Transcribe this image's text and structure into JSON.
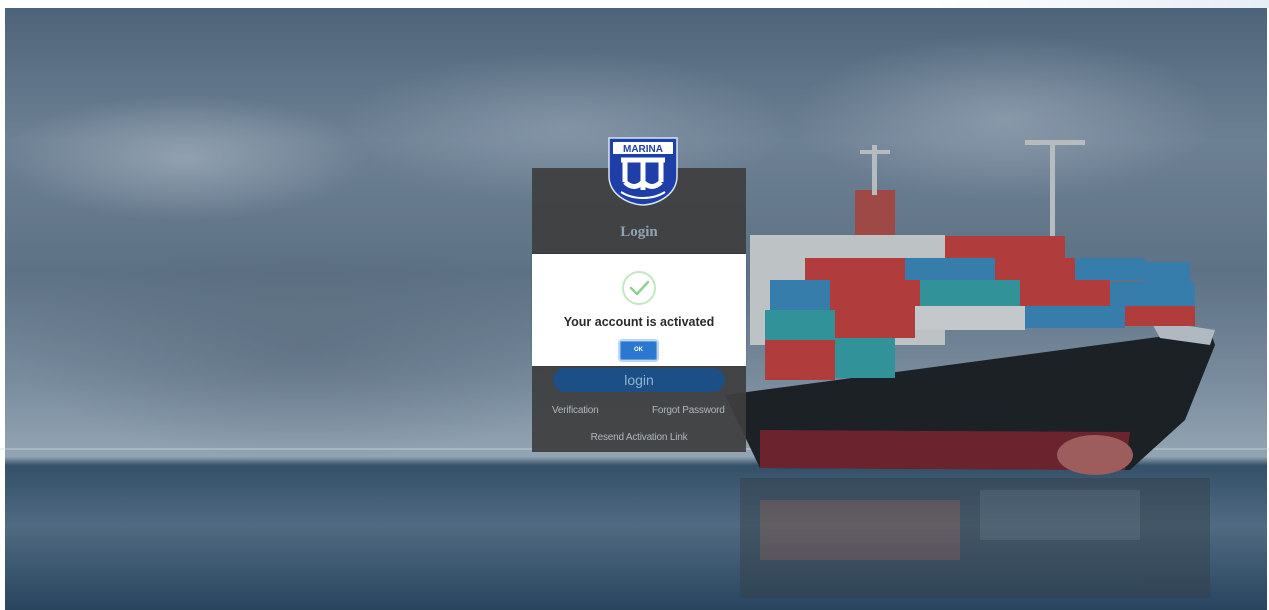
{
  "brand": {
    "logo_text": "MARINA"
  },
  "login": {
    "title": "Login",
    "submit_label": "login",
    "links": {
      "verification": "Verification",
      "forgot_password": "Forgot Password",
      "resend_activation": "Resend Activation Link"
    }
  },
  "dialog": {
    "icon": "success-check-icon",
    "message": "Your account is activated",
    "ok_label": "OK"
  },
  "colors": {
    "panel": "#3e3e3e",
    "login_button": "#1c4f86",
    "ok_button": "#2b78d0",
    "success": "#8fd08f"
  }
}
